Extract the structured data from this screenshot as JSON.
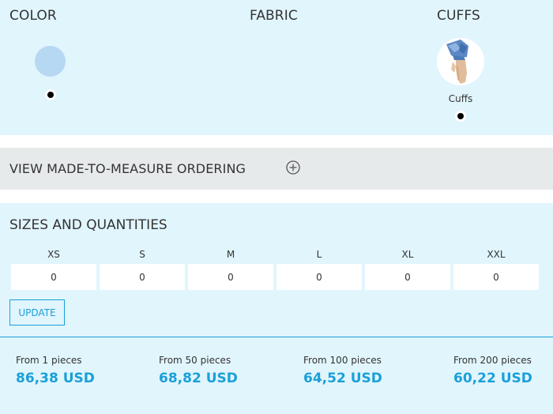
{
  "options": {
    "color_heading": "COLOR",
    "fabric_heading": "FABRIC",
    "cuffs_heading": "CUFFS",
    "selected_color": "#b6d8f2",
    "cuff_label": "Cuffs"
  },
  "made_to_measure": {
    "label": "VIEW MADE-TO-MEASURE ORDERING",
    "icon": "plus-circle-icon"
  },
  "sizes": {
    "title": "SIZES AND QUANTITIES",
    "items": [
      {
        "label": "XS",
        "value": "0"
      },
      {
        "label": "S",
        "value": "0"
      },
      {
        "label": "M",
        "value": "0"
      },
      {
        "label": "L",
        "value": "0"
      },
      {
        "label": "XL",
        "value": "0"
      },
      {
        "label": "XXL",
        "value": "0"
      }
    ],
    "update_label": "UPDATE"
  },
  "pricing": [
    {
      "label": "From 1 pieces",
      "price": "86,38 USD"
    },
    {
      "label": "From 50 pieces",
      "price": "68,82 USD"
    },
    {
      "label": "From 100 pieces",
      "price": "64,52 USD"
    },
    {
      "label": "From 200 pieces",
      "price": "60,22 USD"
    }
  ],
  "colors": {
    "accent": "#1aa0d8",
    "panel_bg": "#e1f5fd",
    "bar_bg": "#e7eaeb"
  }
}
